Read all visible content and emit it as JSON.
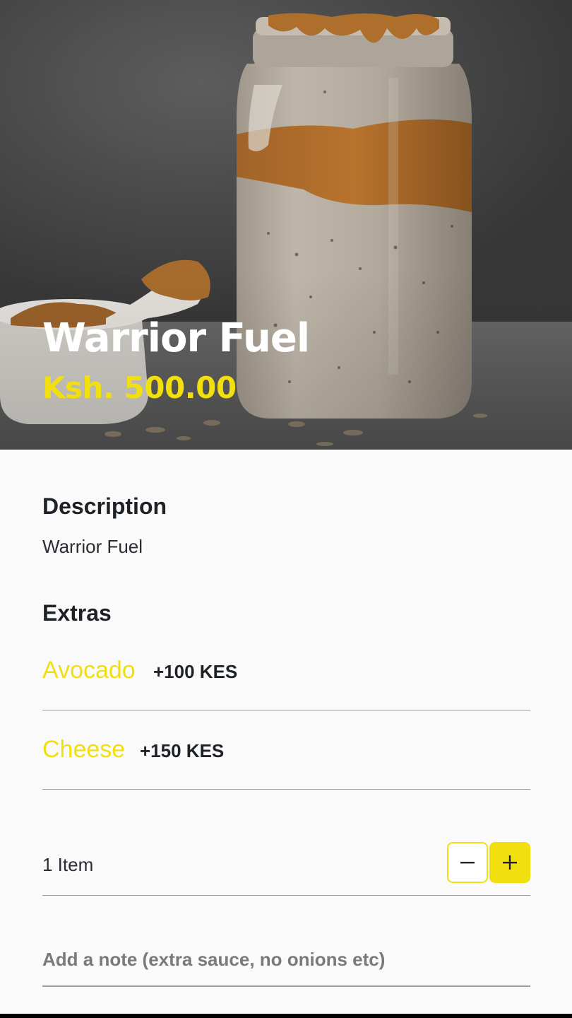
{
  "product": {
    "title": "Warrior Fuel",
    "price": "Ksh. 500.00"
  },
  "description": {
    "heading": "Description",
    "text": "Warrior Fuel"
  },
  "extras": {
    "heading": "Extras",
    "items": [
      {
        "name": "Avocado",
        "price": "+100 KES"
      },
      {
        "name": "Cheese",
        "price": "+150 KES"
      }
    ]
  },
  "quantity": {
    "label": "1 Item",
    "minus": "−",
    "plus": "+"
  },
  "note": {
    "placeholder": "Add a note (extra sauce, no onions etc)"
  },
  "colors": {
    "accent": "#f2df10",
    "text": "#1e2226",
    "background": "#fafafa"
  }
}
